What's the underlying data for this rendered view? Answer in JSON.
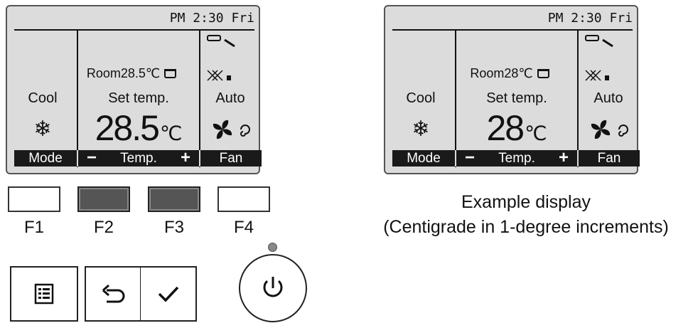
{
  "displays": [
    {
      "status": "PM 2:30 Fri",
      "room": "Room28.5℃",
      "mode": "Cool",
      "set_label": "Set temp.",
      "temp_value": "28.5",
      "temp_unit": "℃",
      "fan": "Auto",
      "fbar": {
        "mode": "Mode",
        "minus": "−",
        "temp": "Temp.",
        "plus": "+",
        "fan": "Fan"
      }
    },
    {
      "status": "PM 2:30 Fri",
      "room": "Room28℃",
      "mode": "Cool",
      "set_label": "Set temp.",
      "temp_value": "28",
      "temp_unit": "℃",
      "fan": "Auto",
      "fbar": {
        "mode": "Mode",
        "minus": "−",
        "temp": "Temp.",
        "plus": "+",
        "fan": "Fan"
      }
    }
  ],
  "function_keys": [
    "F1",
    "F2",
    "F3",
    "F4"
  ],
  "caption": {
    "line1": "Example display",
    "line2": "(Centigrade in 1-degree increments)"
  },
  "icons": {
    "menu": "menu-icon",
    "back": "return-icon",
    "confirm": "checkmark-icon",
    "power": "power-icon",
    "mode": "snowflake-icon",
    "fan": "fan-icon",
    "vane": "vane-icon",
    "louver": "louver-icon",
    "drain": "drain-icon"
  },
  "colors": {
    "lcd_background": "#dcdcdc",
    "softkey_bar": "#1a1a1a",
    "pressed_key": "#555555"
  }
}
